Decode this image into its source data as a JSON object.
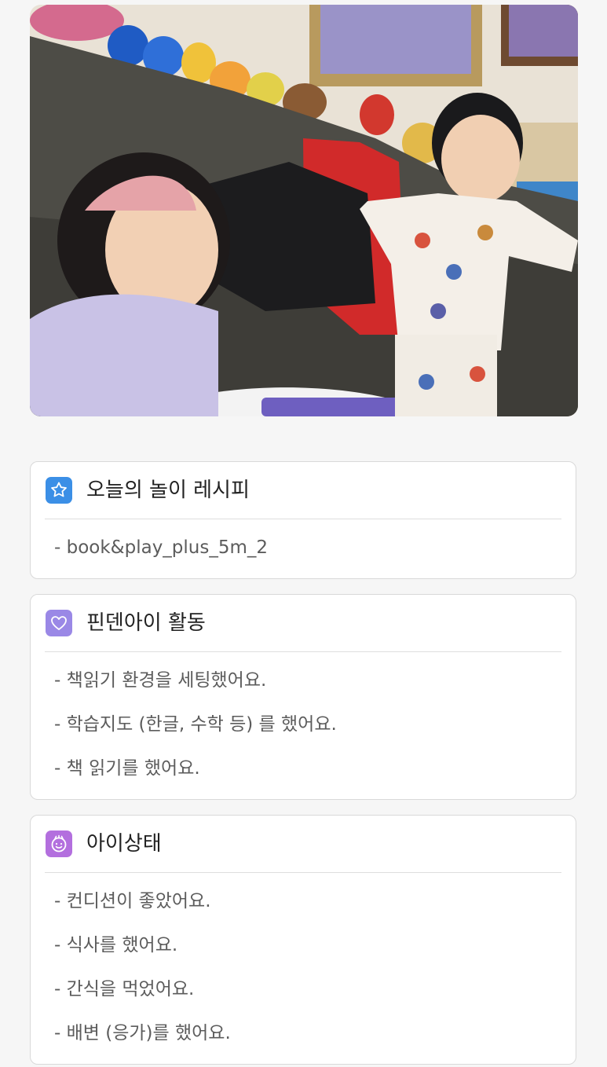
{
  "cards": [
    {
      "title": "오늘의 놀이 레시피",
      "icon": "star-icon",
      "color": "#3b8fe6",
      "items": [
        "- book&play_plus_5m_2"
      ]
    },
    {
      "title": "핀덴아이 활동",
      "icon": "heart-icon",
      "color": "#9a88e6",
      "items": [
        "- 책읽기 환경을 세팅했어요.",
        "- 학습지도 (한글, 수학 등) 를 했어요.",
        "- 책 읽기를 했어요."
      ]
    },
    {
      "title": "아이상태",
      "icon": "smiley-face-icon",
      "color": "#b36fde",
      "items": [
        "- 컨디션이 좋았어요.",
        "- 식사를 했어요.",
        "- 간식을 먹었어요.",
        "- 배변 (응가)를 했어요."
      ]
    }
  ]
}
